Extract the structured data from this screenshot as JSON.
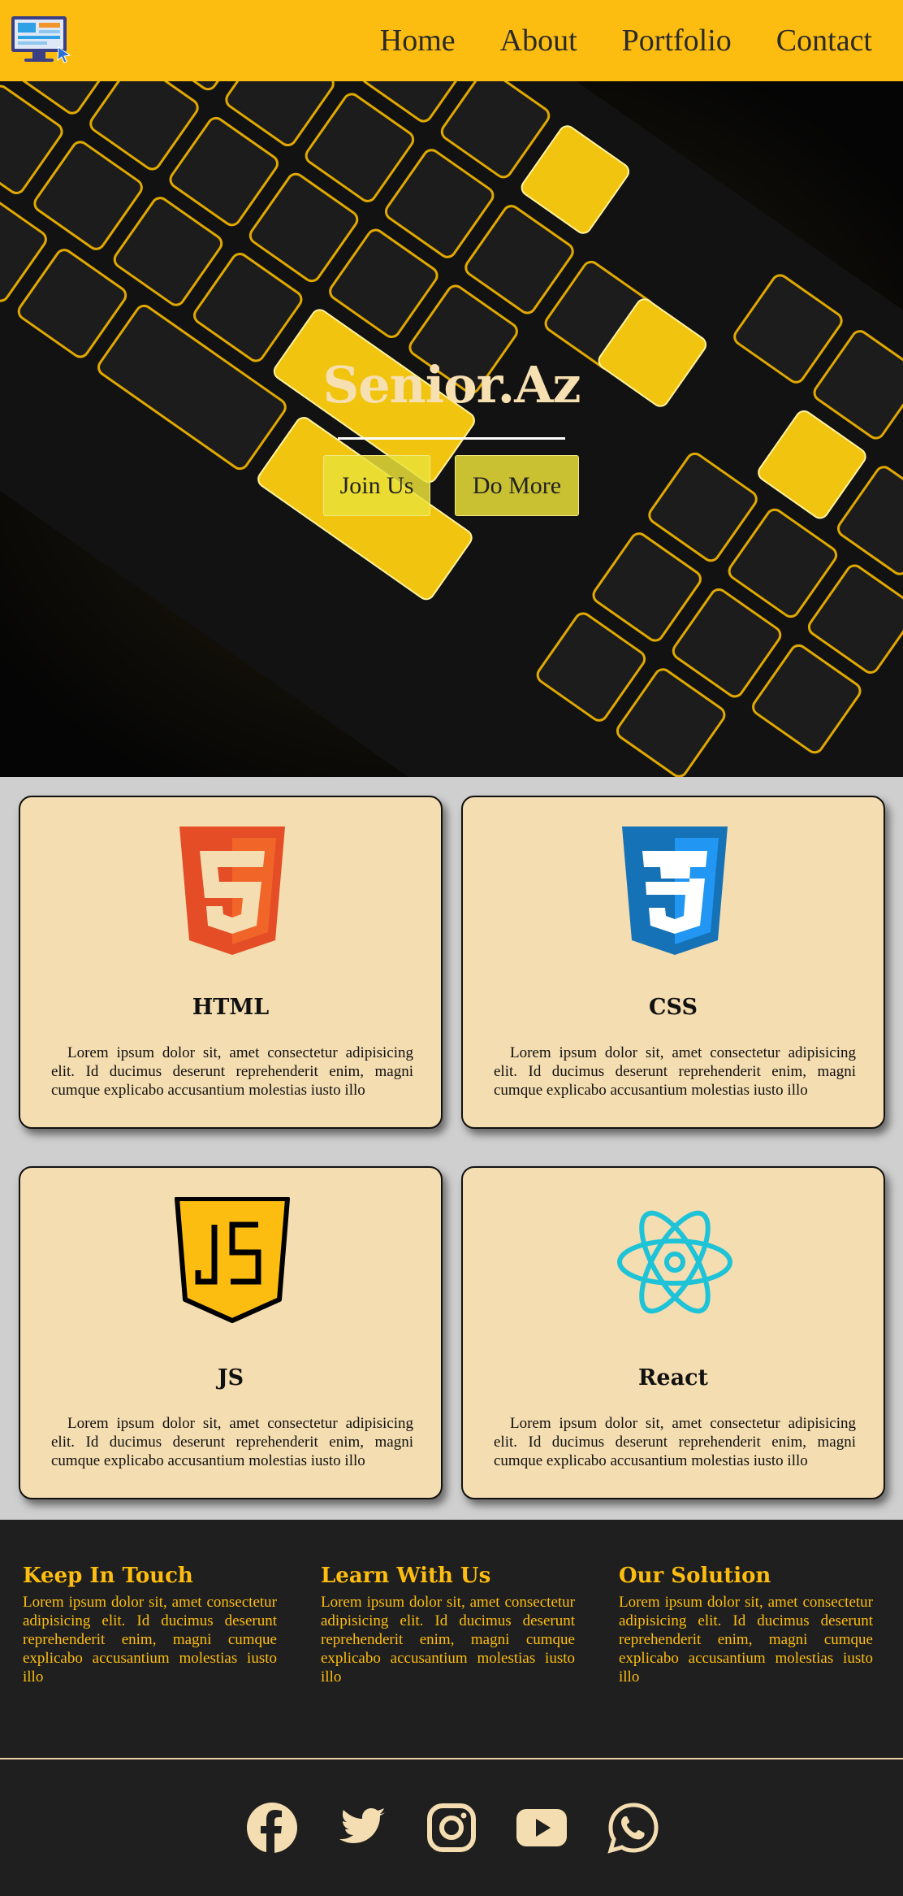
{
  "nav": {
    "logo_icon": "monitor-logo-icon",
    "links": [
      "Home",
      "About",
      "Portfolio",
      "Contact"
    ]
  },
  "hero": {
    "title": "Senior.Az",
    "buttons": [
      "Join Us",
      "Do More"
    ]
  },
  "cards": [
    {
      "title": "HTML",
      "icon": "html5-icon",
      "text": "Lorem ipsum dolor sit, amet consectetur adipisicing elit. Id ducimus deserunt reprehenderit enim, magni cumque explicabo accusantium molestias iusto illo"
    },
    {
      "title": "CSS",
      "icon": "css3-icon",
      "text": "Lorem ipsum dolor sit, amet consectetur adipisicing elit. Id ducimus deserunt reprehenderit enim, magni cumque explicabo accusantium molestias iusto illo"
    },
    {
      "title": "JS",
      "icon": "javascript-icon",
      "text": "Lorem ipsum dolor sit, amet consectetur adipisicing elit. Id ducimus deserunt reprehenderit enim, magni cumque explicabo accusantium molestias iusto illo"
    },
    {
      "title": "React",
      "icon": "react-icon",
      "text": "Lorem ipsum dolor sit, amet consectetur adipisicing elit. Id ducimus deserunt reprehenderit enim, magni cumque explicabo accusantium molestias iusto illo"
    }
  ],
  "footer": {
    "columns": [
      {
        "title": "Keep In Touch",
        "text": "Lorem ipsum dolor sit, amet consectetur adipisicing elit. Id ducimus deserunt reprehenderit enim, magni cumque explicabo accusantium molestias iusto illo"
      },
      {
        "title": "Learn With Us",
        "text": "Lorem ipsum dolor sit, amet consectetur adipisicing elit. Id ducimus deserunt reprehenderit enim, magni cumque explicabo accusantium molestias iusto illo"
      },
      {
        "title": "Our Solution",
        "text": "Lorem ipsum dolor sit, amet consectetur adipisicing elit. Id ducimus deserunt reprehenderit enim, magni cumque explicabo accusantium molestias iusto illo"
      }
    ],
    "socials": [
      "facebook-icon",
      "twitter-icon",
      "instagram-icon",
      "youtube-icon",
      "whatsapp-icon"
    ]
  },
  "colors": {
    "brand_yellow": "#fdbd10",
    "card_bg": "#f4ddb0",
    "footer_bg": "#1f1f1f",
    "hero_title": "#f6dfb0"
  }
}
